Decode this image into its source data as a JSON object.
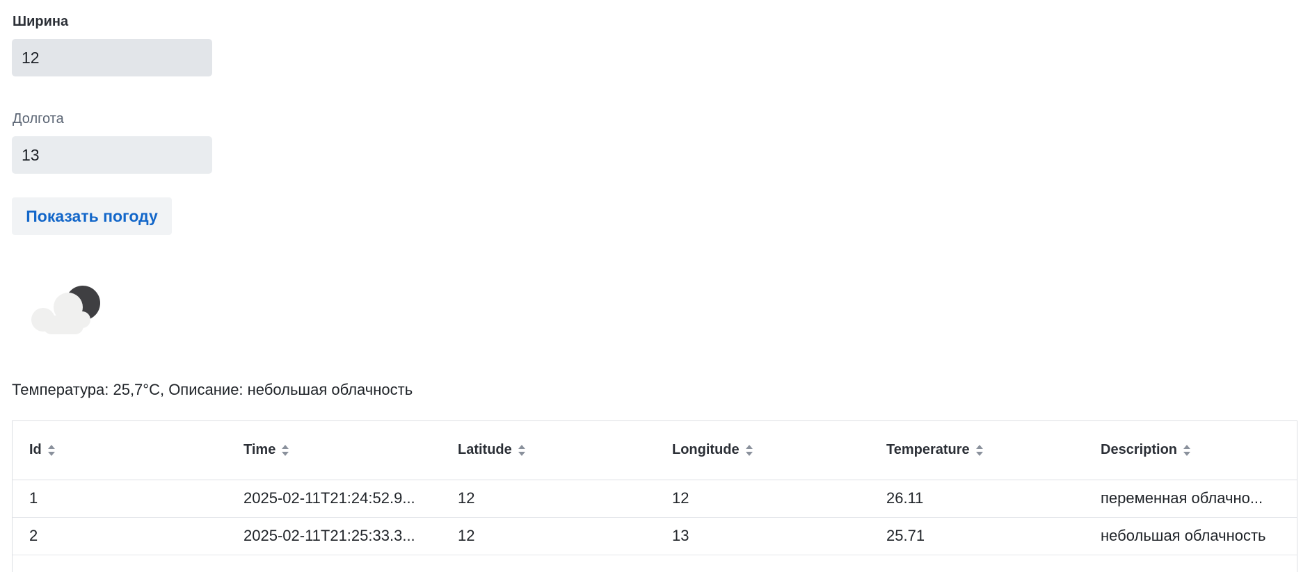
{
  "form": {
    "latitude_label": "Ширина",
    "latitude_value": "12",
    "longitude_label": "Долгота",
    "longitude_value": "13",
    "submit_label": "Показать погоду"
  },
  "weather": {
    "icon": "night-partly-cloudy-icon",
    "summary": "Температура: 25,7°C, Описание: небольшая облачность"
  },
  "table": {
    "columns": [
      "Id",
      "Time",
      "Latitude",
      "Longitude",
      "Temperature",
      "Description"
    ],
    "rows": [
      [
        "1",
        "2025-02-11T21:24:52.9...",
        "12",
        "12",
        "26.11",
        "переменная облачно..."
      ],
      [
        "2",
        "2025-02-11T21:25:33.3...",
        "12",
        "13",
        "25.71",
        "небольшая облачность"
      ]
    ]
  },
  "colors": {
    "accent": "#1266c9",
    "input_bg": "#e2e5e9",
    "button_bg": "#f1f3f5",
    "border": "#dcdfe3"
  }
}
